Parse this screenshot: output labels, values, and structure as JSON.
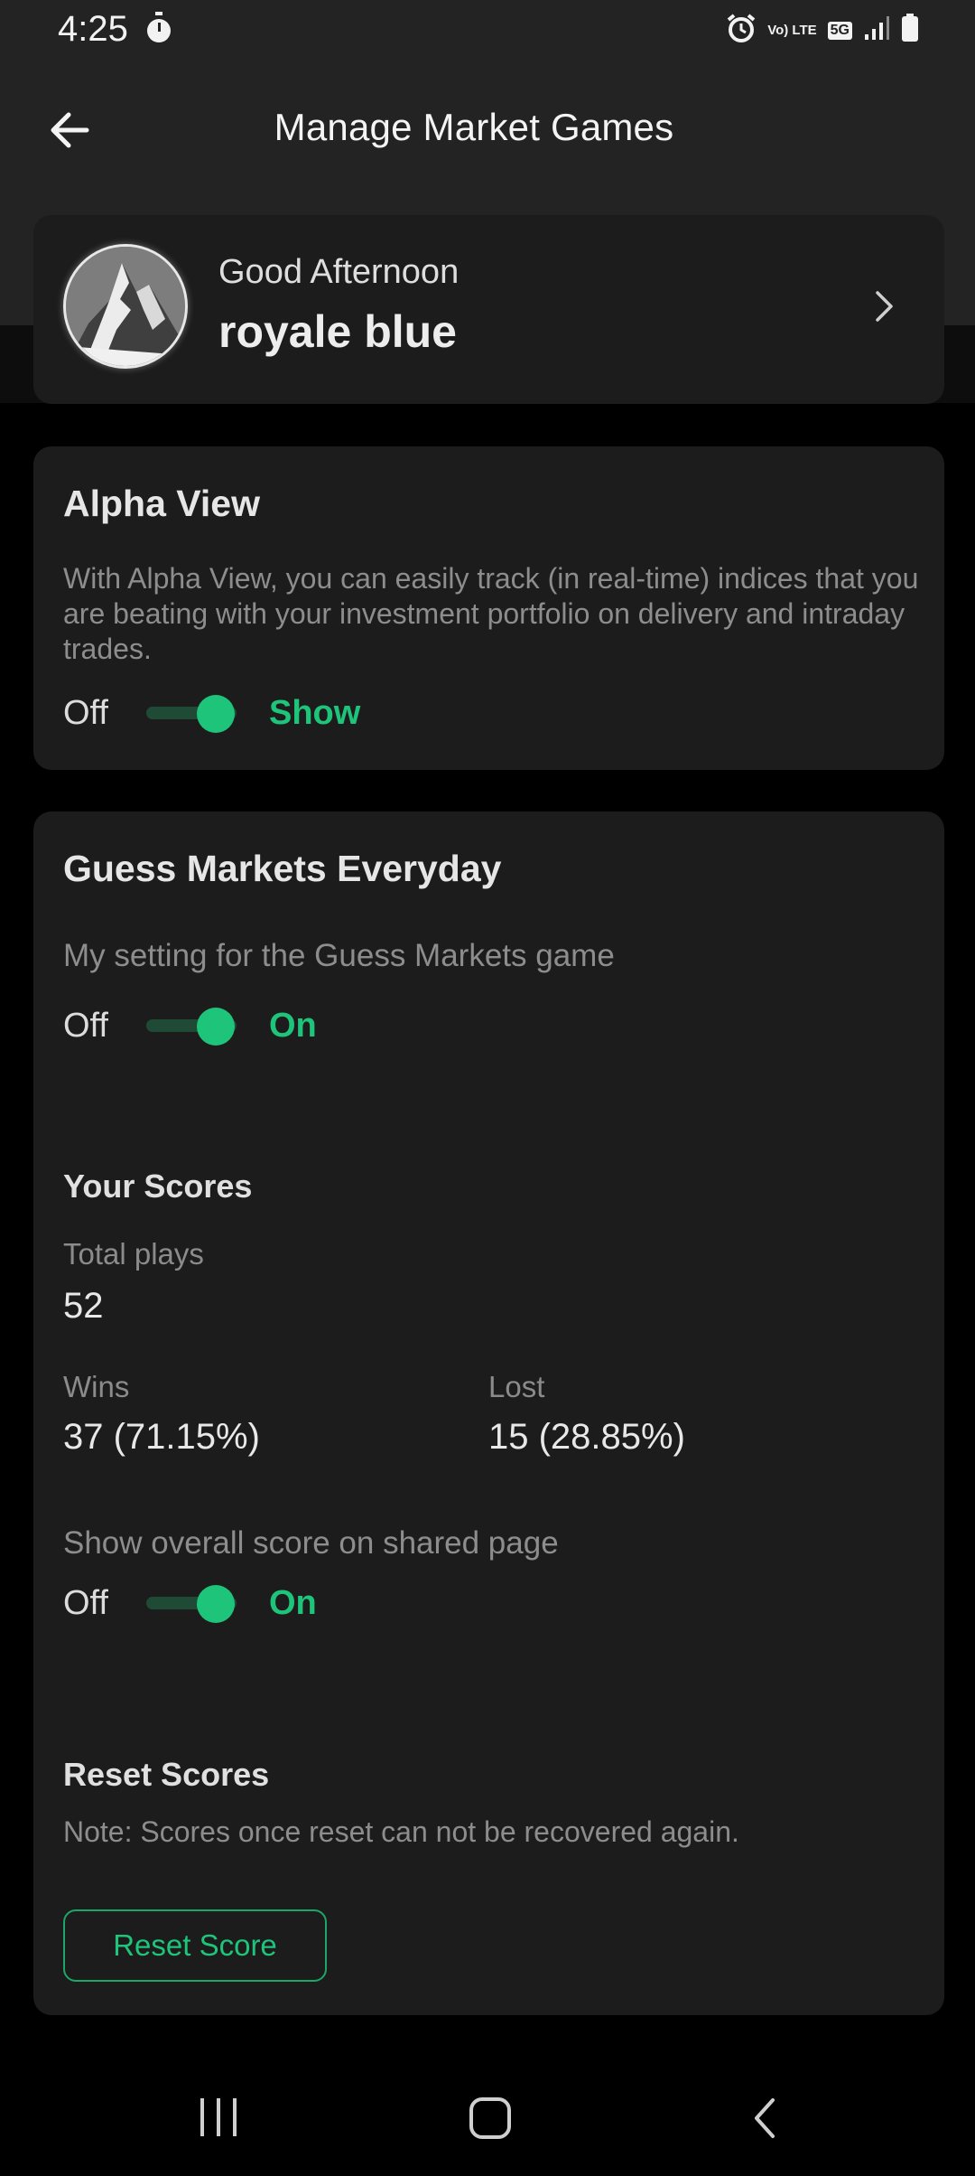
{
  "status_bar": {
    "time": "4:25",
    "network_label": "Vo) LTE",
    "network_type": "5G",
    "icons": [
      "stopwatch-icon",
      "alarm-icon",
      "volte-icon",
      "5g-icon",
      "signal-icon",
      "battery-icon"
    ]
  },
  "header": {
    "title": "Manage Market Games",
    "back_icon": "arrow-left-icon"
  },
  "profile": {
    "greeting": "Good Afternoon",
    "name": "royale blue",
    "chevron_icon": "chevron-right-icon"
  },
  "alpha_view": {
    "title": "Alpha View",
    "description": "With Alpha View, you can easily track (in real-time) indices that you are beating with your investment portfolio on delivery and intraday trades.",
    "off_label": "Off",
    "on_label": "Show",
    "enabled": true
  },
  "guess_markets": {
    "title": "Guess Markets Everyday",
    "setting_label": "My setting for the Guess Markets game",
    "off_label": "Off",
    "on_label": "On",
    "enabled": true,
    "scores": {
      "title": "Your Scores",
      "total_plays_label": "Total plays",
      "total_plays_value": "52",
      "wins_label": "Wins",
      "wins_value": "37 (71.15%)",
      "lost_label": "Lost",
      "lost_value": "15 (28.85%)"
    },
    "share": {
      "label": "Show overall score on shared page",
      "off_label": "Off",
      "on_label": "On",
      "enabled": true
    },
    "reset": {
      "title": "Reset Scores",
      "note": "Note: Scores once reset can not be recovered again.",
      "button_label": "Reset Score"
    }
  },
  "colors": {
    "accent": "#1ec47a",
    "card_bg": "#1c1c1c",
    "header_bg": "#232323",
    "page_bg": "#000000"
  },
  "nav_bar": {
    "icons": [
      "recent-apps-icon",
      "home-icon",
      "back-icon"
    ]
  }
}
